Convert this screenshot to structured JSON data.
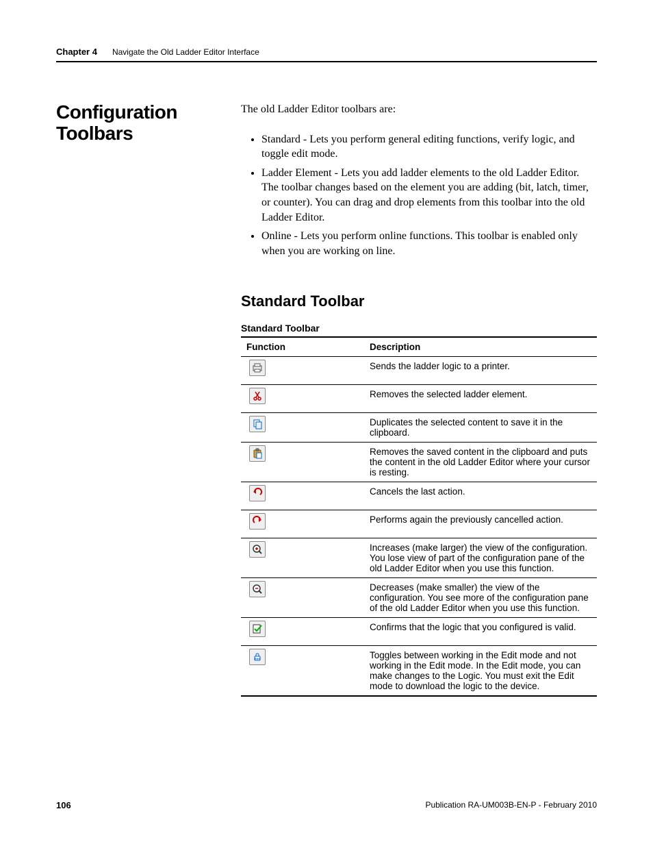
{
  "header": {
    "chapter": "Chapter 4",
    "title": "Navigate the Old Ladder Editor Interface"
  },
  "section_title": "Configuration Toolbars",
  "intro": "The old Ladder Editor toolbars are:",
  "bullets": [
    "Standard - Lets you perform general editing functions, verify logic, and toggle edit mode.",
    "Ladder Element - Lets you add ladder elements to the old Ladder Editor. The toolbar changes based on the element you are adding (bit, latch, timer, or counter). You can drag and drop elements from this toolbar into the old Ladder Editor.",
    "Online - Lets you perform online functions. This toolbar is enabled only when you are working on line."
  ],
  "subhead": "Standard Toolbar",
  "table": {
    "caption": "Standard Toolbar",
    "headers": {
      "col1": "Function",
      "col2": "Description"
    },
    "rows": [
      {
        "icon": "print-icon",
        "desc": "Sends the ladder logic to a printer."
      },
      {
        "icon": "cut-icon",
        "desc": "Removes the selected ladder element."
      },
      {
        "icon": "copy-icon",
        "desc": "Duplicates the selected content to save it in the clipboard."
      },
      {
        "icon": "paste-icon",
        "desc": "Removes the saved content in the clipboard and puts the content in the old Ladder Editor where your cursor is resting."
      },
      {
        "icon": "undo-icon",
        "desc": "Cancels the last action."
      },
      {
        "icon": "redo-icon",
        "desc": "Performs again the previously cancelled action."
      },
      {
        "icon": "zoom-in-icon",
        "desc": "Increases (make larger) the view of the configuration. You lose view of part of the configuration pane of the old Ladder Editor when you use this function."
      },
      {
        "icon": "zoom-out-icon",
        "desc": "Decreases (make smaller) the view of the configuration. You see more of the configuration pane of the old Ladder Editor when you use this function."
      },
      {
        "icon": "verify-icon",
        "desc": "Confirms that the logic that you configured is valid."
      },
      {
        "icon": "edit-mode-icon",
        "desc": "Toggles between working in the Edit mode and not working in the Edit mode. In the Edit mode, you can make changes to the Logic. You must exit the Edit mode to download the logic to the device."
      }
    ]
  },
  "footer": {
    "page": "106",
    "pub": "Publication RA-UM003B-EN-P - February 2010"
  }
}
